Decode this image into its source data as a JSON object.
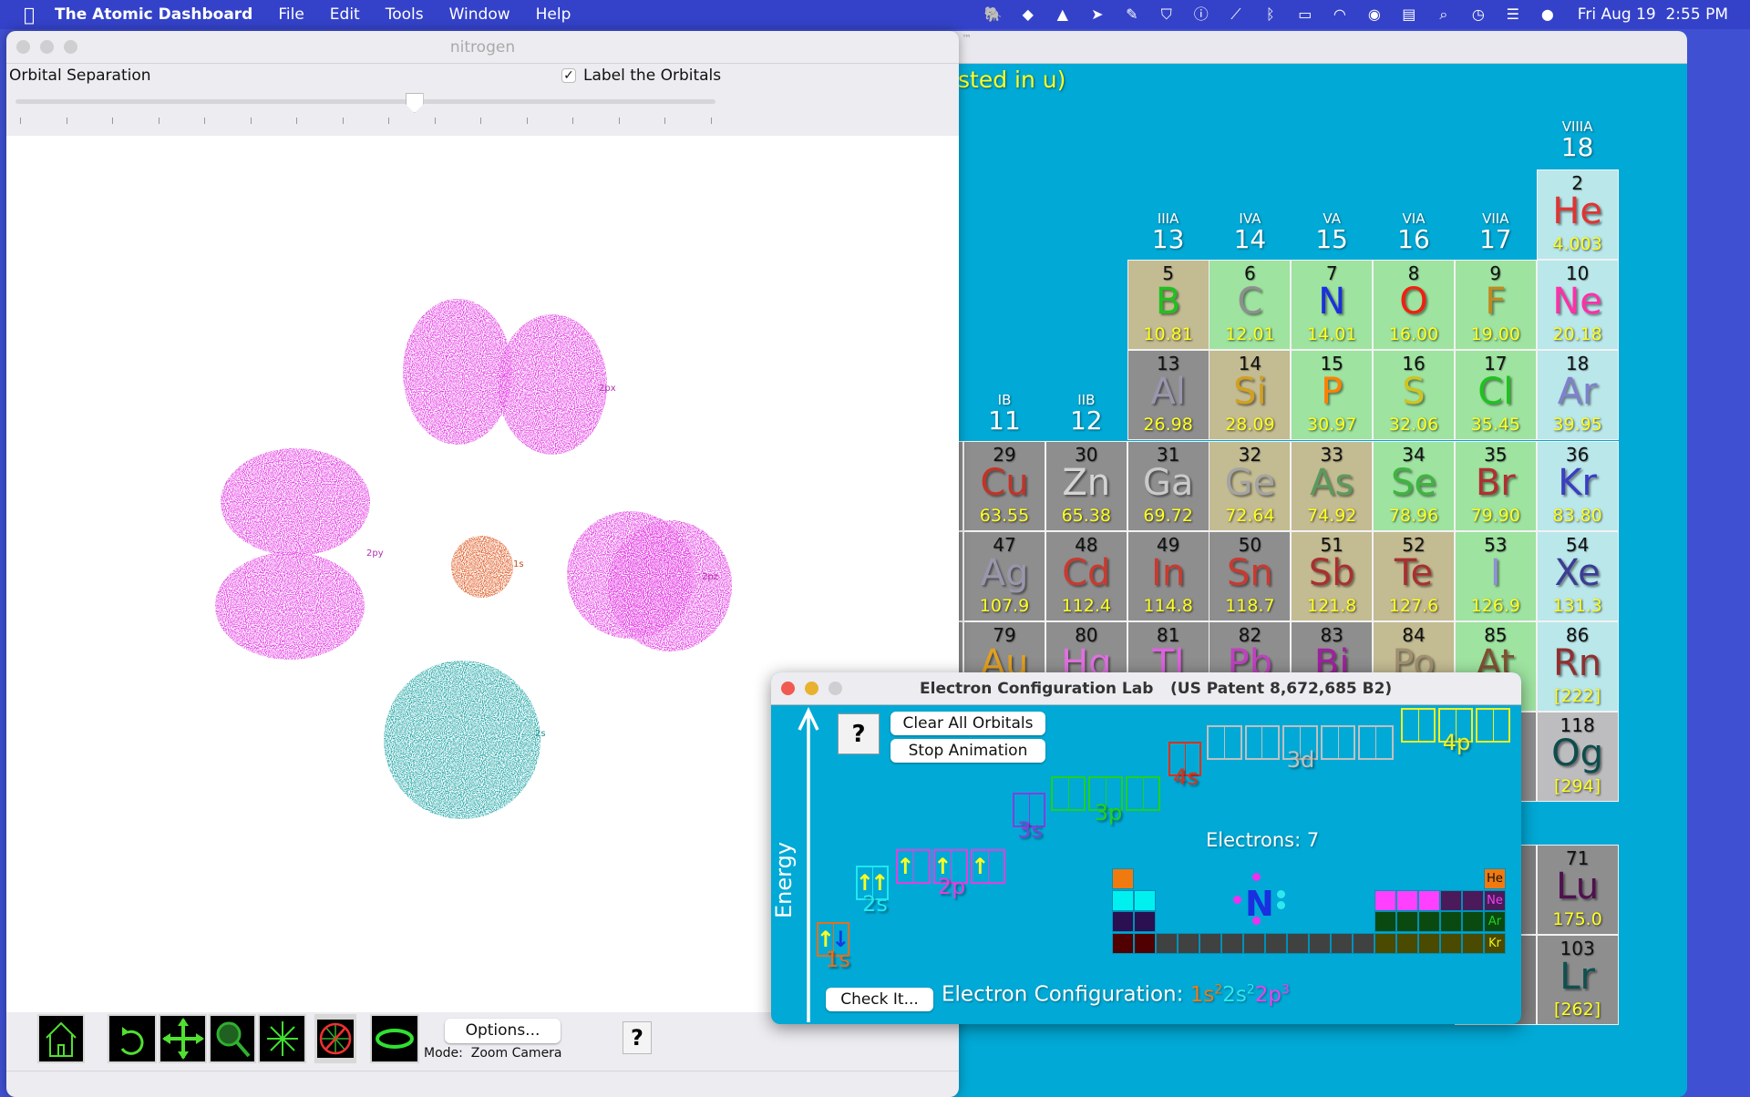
{
  "menubar": {
    "app": "The Atomic Dashboard",
    "items": [
      "File",
      "Edit",
      "Tools",
      "Window",
      "Help"
    ],
    "clock": "Fri Aug 19  2:55 PM",
    "status_icons": [
      "elephant-icon",
      "dropbox-icon",
      "drive-icon",
      "airmail-icon",
      "note-icon",
      "shield-icon",
      "accessibility-icon",
      "signal-off-icon",
      "bluetooth-icon",
      "battery-charging-icon",
      "wifi-icon",
      "user-icon",
      "calendar-icon",
      "search-icon",
      "time-machine-icon",
      "control-center-icon",
      "siri-icon"
    ]
  },
  "background_window": {
    "title_fragment": "™",
    "subtitle_fragment": "sted in u)",
    "groups": [
      {
        "g": 11,
        "roman": "IB"
      },
      {
        "g": 12,
        "roman": "IIB"
      },
      {
        "g": 13,
        "roman": "IIIA"
      },
      {
        "g": 14,
        "roman": "IVA"
      },
      {
        "g": 15,
        "roman": "VA"
      },
      {
        "g": 16,
        "roman": "VIA"
      },
      {
        "g": 17,
        "roman": "VIIA"
      },
      {
        "g": 18,
        "roman": "VIIIA"
      }
    ],
    "category_colors": {
      "metal": "#8e8e8e",
      "metalloid": "#c3bb92",
      "nonmetal": "#9ee3a0",
      "noble": "#b9e7ea",
      "synthetic": "#bdbdc0"
    },
    "elements": [
      {
        "n": "2",
        "s": "He",
        "m": "4.003",
        "g": 18,
        "p": 1,
        "cat": "noble",
        "c": "#e03434"
      },
      {
        "n": "5",
        "s": "B",
        "m": "10.81",
        "g": 13,
        "p": 2,
        "cat": "metalloid",
        "c": "#1fc21f"
      },
      {
        "n": "6",
        "s": "C",
        "m": "12.01",
        "g": 14,
        "p": 2,
        "cat": "nonmetal",
        "c": "#8f8f8f"
      },
      {
        "n": "7",
        "s": "N",
        "m": "14.01",
        "g": 15,
        "p": 2,
        "cat": "nonmetal",
        "c": "#1a2fe0"
      },
      {
        "n": "8",
        "s": "O",
        "m": "16.00",
        "g": 16,
        "p": 2,
        "cat": "nonmetal",
        "c": "#f02010"
      },
      {
        "n": "9",
        "s": "F",
        "m": "19.00",
        "g": 17,
        "p": 2,
        "cat": "nonmetal",
        "c": "#c08a20"
      },
      {
        "n": "10",
        "s": "Ne",
        "m": "20.18",
        "g": 18,
        "p": 2,
        "cat": "noble",
        "c": "#ff30a8"
      },
      {
        "n": "13",
        "s": "Al",
        "m": "26.98",
        "g": 13,
        "p": 3,
        "cat": "metal",
        "c": "#9a96ad"
      },
      {
        "n": "14",
        "s": "Si",
        "m": "28.09",
        "g": 14,
        "p": 3,
        "cat": "metalloid",
        "c": "#d0a020"
      },
      {
        "n": "15",
        "s": "P",
        "m": "30.97",
        "g": 15,
        "p": 3,
        "cat": "nonmetal",
        "c": "#ff8000"
      },
      {
        "n": "16",
        "s": "S",
        "m": "32.06",
        "g": 16,
        "p": 3,
        "cat": "nonmetal",
        "c": "#d0c420"
      },
      {
        "n": "17",
        "s": "Cl",
        "m": "35.45",
        "g": 17,
        "p": 3,
        "cat": "nonmetal",
        "c": "#1fc21f"
      },
      {
        "n": "18",
        "s": "Ar",
        "m": "39.95",
        "g": 18,
        "p": 3,
        "cat": "noble",
        "c": "#8080cc"
      },
      {
        "n": "29",
        "s": "Cu",
        "m": "63.55",
        "g": 11,
        "p": 4,
        "cat": "metal",
        "c": "#c03428"
      },
      {
        "n": "30",
        "s": "Zn",
        "m": "65.38",
        "g": 12,
        "p": 4,
        "cat": "metal",
        "c": "#d4d4d4"
      },
      {
        "n": "31",
        "s": "Ga",
        "m": "69.72",
        "g": 13,
        "p": 4,
        "cat": "metal",
        "c": "#cacaca"
      },
      {
        "n": "32",
        "s": "Ge",
        "m": "72.64",
        "g": 14,
        "p": 4,
        "cat": "metalloid",
        "c": "#a4a4a4"
      },
      {
        "n": "33",
        "s": "As",
        "m": "74.92",
        "g": 15,
        "p": 4,
        "cat": "metalloid",
        "c": "#5c9a5c"
      },
      {
        "n": "34",
        "s": "Se",
        "m": "78.96",
        "g": 16,
        "p": 4,
        "cat": "nonmetal",
        "c": "#40b440"
      },
      {
        "n": "35",
        "s": "Br",
        "m": "79.90",
        "g": 17,
        "p": 4,
        "cat": "nonmetal",
        "c": "#b03030"
      },
      {
        "n": "36",
        "s": "Kr",
        "m": "83.80",
        "g": 18,
        "p": 4,
        "cat": "noble",
        "c": "#3c3cc4"
      },
      {
        "n": "47",
        "s": "Ag",
        "m": "107.9",
        "g": 11,
        "p": 5,
        "cat": "metal",
        "c": "#9a96ad"
      },
      {
        "n": "48",
        "s": "Cd",
        "m": "112.4",
        "g": 12,
        "p": 5,
        "cat": "metal",
        "c": "#c83a30"
      },
      {
        "n": "49",
        "s": "In",
        "m": "114.8",
        "g": 13,
        "p": 5,
        "cat": "metal",
        "c": "#c83a30"
      },
      {
        "n": "50",
        "s": "Sn",
        "m": "118.7",
        "g": 14,
        "p": 5,
        "cat": "metal",
        "c": "#c83a30"
      },
      {
        "n": "51",
        "s": "Sb",
        "m": "121.8",
        "g": 15,
        "p": 5,
        "cat": "metalloid",
        "c": "#a83030"
      },
      {
        "n": "52",
        "s": "Te",
        "m": "127.6",
        "g": 16,
        "p": 5,
        "cat": "metalloid",
        "c": "#a83030"
      },
      {
        "n": "53",
        "s": "I",
        "m": "126.9",
        "g": 17,
        "p": 5,
        "cat": "nonmetal",
        "c": "#9090d4"
      },
      {
        "n": "54",
        "s": "Xe",
        "m": "131.3",
        "g": 18,
        "p": 5,
        "cat": "noble",
        "c": "#3c3c94"
      },
      {
        "n": "79",
        "s": "Au",
        "m": "",
        "g": 11,
        "p": 6,
        "cat": "metal",
        "c": "#e0a020"
      },
      {
        "n": "80",
        "s": "Hg",
        "m": "",
        "g": 12,
        "p": 6,
        "cat": "metal",
        "c": "#e070e0"
      },
      {
        "n": "81",
        "s": "Tl",
        "m": "",
        "g": 13,
        "p": 6,
        "cat": "metal",
        "c": "#e060e0"
      },
      {
        "n": "82",
        "s": "Pb",
        "m": "",
        "g": 14,
        "p": 6,
        "cat": "metal",
        "c": "#c040c0"
      },
      {
        "n": "83",
        "s": "Bi",
        "m": "",
        "g": 15,
        "p": 6,
        "cat": "metal",
        "c": "#a020a0"
      },
      {
        "n": "84",
        "s": "Po",
        "m": "",
        "g": 16,
        "p": 6,
        "cat": "metalloid",
        "c": "#a09070"
      },
      {
        "n": "85",
        "s": "At",
        "m": "",
        "g": 17,
        "p": 6,
        "cat": "nonmetal",
        "c": "#805030"
      },
      {
        "n": "86",
        "s": "Rn",
        "m": "[222]",
        "g": 18,
        "p": 6,
        "cat": "noble",
        "c": "#903030"
      },
      {
        "n": "118",
        "s": "Og",
        "m": "[294]",
        "g": 18,
        "p": 7,
        "cat": "synthetic",
        "c": "#0f4c4c"
      },
      {
        "n": "71",
        "s": "Lu",
        "m": "175.0",
        "g": 18,
        "p": "La",
        "cat": "metal",
        "c": "#501050"
      },
      {
        "n": "103",
        "s": "Lr",
        "m": "[262]",
        "g": 18,
        "p": "Ac",
        "cat": "metal",
        "c": "#0f5050"
      }
    ]
  },
  "nitrogen_window": {
    "title": "nitrogen",
    "slider_label": "Orbital Separation",
    "slider_value": 0.57,
    "slider_ticks": 16,
    "label_checkbox": {
      "label": "Label the Orbitals",
      "checked": true
    },
    "orbital_labels": {
      "2px": "2px",
      "2py": "2py",
      "2pz": "2pz",
      "1s": "1s",
      "2s": "2s"
    },
    "orbital_colors": {
      "2p": "#e43ce4",
      "1s": "#e0602a",
      "2s": "#28a8a8"
    },
    "toolbar": {
      "options": "Options...",
      "mode": "Mode:  Zoom Camera",
      "help": "?"
    }
  },
  "ecl": {
    "title": "Electron Configuration Lab",
    "patent": "(US Patent 8,672,685 B2)",
    "help": "?",
    "clear": "Clear All Orbitals",
    "stop": "Stop Animation",
    "energy": "Energy",
    "electrons": "Electrons: 7",
    "check": "Check It...",
    "config_label": "Electron Configuration:",
    "config": [
      {
        "orb": "1s",
        "exp": "2",
        "color": "#f07a1a"
      },
      {
        "orb": "2s",
        "exp": "2",
        "color": "#2de8ee"
      },
      {
        "orb": "2p",
        "exp": "3",
        "color": "#f040f0"
      }
    ],
    "orbitals": [
      {
        "label": "1s",
        "color": "#e86f1a",
        "boxes": [
          [
            "up",
            "down"
          ]
        ]
      },
      {
        "label": "2s",
        "color": "#20e8f0",
        "boxes": [
          [
            "up",
            "up"
          ]
        ]
      },
      {
        "label": "2p",
        "color": "#e040e0",
        "boxes": [
          [
            "up",
            ""
          ],
          [
            "up",
            ""
          ],
          [
            "up",
            ""
          ]
        ]
      },
      {
        "label": "3s",
        "color": "#8040e0",
        "boxes": [
          [
            "",
            ""
          ]
        ]
      },
      {
        "label": "3p",
        "color": "#20d020",
        "boxes": [
          [
            "",
            ""
          ],
          [
            "",
            ""
          ],
          [
            "",
            ""
          ]
        ]
      },
      {
        "label": "4s",
        "color": "#e03018",
        "boxes": [
          [
            "",
            ""
          ]
        ]
      },
      {
        "label": "3d",
        "color": "#c0c0c0",
        "boxes": [
          [
            "",
            ""
          ],
          [
            "",
            ""
          ],
          [
            "",
            ""
          ],
          [
            "",
            ""
          ],
          [
            "",
            ""
          ]
        ]
      },
      {
        "label": "4p",
        "color": "#f0f020",
        "boxes": [
          [
            "",
            ""
          ],
          [
            "",
            ""
          ],
          [
            "",
            ""
          ]
        ]
      }
    ],
    "symbol": "N",
    "symbol_color": "#1a2fe0",
    "mini_table": {
      "labels": [
        {
          "t": "He",
          "c": "#111111"
        },
        {
          "t": "Ne",
          "c": "#f040f0"
        },
        {
          "t": "Ar",
          "c": "#20d020"
        },
        {
          "t": "Kr",
          "c": "#f0f020"
        }
      ],
      "rows": [
        {
          "1": "#f07a10",
          "18": "#f07a10"
        },
        {
          "1": "#00f0f0",
          "2": "#00f0f0",
          "13": "#ff40ff",
          "14": "#ff40ff",
          "15": "#ff40ff",
          "16": "#4a1a5a",
          "17": "#4a1a5a",
          "18": "#4a1a5a"
        },
        {
          "1": "#2a1050",
          "2": "#2a1050",
          "13": "#0a4a10",
          "14": "#0a4a10",
          "15": "#0a4a10",
          "16": "#0a4a10",
          "17": "#0a4a10",
          "18": "#0a4a10"
        },
        {
          "1": "#500000",
          "2": "#500000",
          "3": "#404242",
          "4": "#404242",
          "5": "#404242",
          "6": "#404242",
          "7": "#404242",
          "8": "#404242",
          "9": "#404242",
          "10": "#404242",
          "11": "#404242",
          "12": "#404242",
          "13": "#4a4a00",
          "14": "#4a4a00",
          "15": "#4a4a00",
          "16": "#4a4a00",
          "17": "#4a4a00",
          "18": "#4a4a00"
        }
      ]
    }
  }
}
